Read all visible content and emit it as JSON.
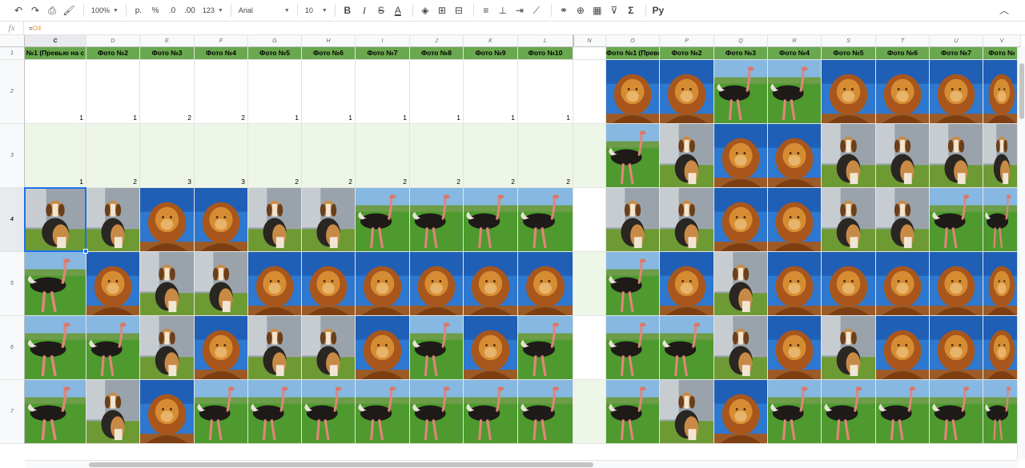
{
  "toolbar": {
    "zoom": "100%",
    "currency": "р.",
    "percent": "%",
    "decrease_decimals": ".0",
    "increase_decimals": ".00",
    "more_formats": "123",
    "font_name": "Arial",
    "font_size": "10",
    "bold": "B",
    "italic": "I",
    "strikethrough": "S",
    "text_color": "A",
    "functions": "Σ",
    "input_language": "Ру"
  },
  "formula_bar": {
    "fx": "fx",
    "equals": "=",
    "ref": "O4"
  },
  "columns": [
    "C",
    "D",
    "E",
    "F",
    "G",
    "H",
    "I",
    "J",
    "K",
    "L",
    "N",
    "O",
    "P",
    "Q",
    "R",
    "S",
    "T",
    "U",
    "V"
  ],
  "rows": [
    "1",
    "2",
    "3",
    "4",
    "5",
    "6",
    "7"
  ],
  "header_row": [
    "№1 (Превью на с",
    "Фото №2",
    "Фото №3",
    "Фото №4",
    "Фото №5",
    "Фото №6",
    "Фото №7",
    "Фото №8",
    "Фото №9",
    "Фото №10",
    "",
    "Фото №1 (Превью на",
    "Фото №2",
    "Фото №3",
    "Фото №4",
    "Фото №5",
    "Фото №6",
    "Фото №7",
    "Фото №"
  ],
  "number_rows": [
    [
      "1",
      "1",
      "2",
      "2",
      "1",
      "1",
      "1",
      "1",
      "1",
      "1"
    ],
    [
      "1",
      "2",
      "3",
      "3",
      "2",
      "2",
      "2",
      "2",
      "2",
      "2"
    ]
  ],
  "photo_grid_left": [
    [
      "dog",
      "dog",
      "lion",
      "lion",
      "dog",
      "dog",
      "ostrich",
      "ostrich",
      "ostrich",
      "ostrich"
    ],
    [
      "ostrich",
      "lion",
      "dog",
      "dog",
      "lion",
      "lion",
      "lion",
      "lion",
      "lion",
      "lion"
    ],
    [
      "ostrich",
      "ostrich",
      "dog",
      "lion",
      "dog",
      "dog",
      "lion",
      "ostrich",
      "lion",
      "ostrich"
    ],
    [
      "ostrich",
      "dog",
      "lion",
      "ostrich",
      "ostrich",
      "ostrich",
      "ostrich",
      "ostrich",
      "ostrich",
      "ostrich"
    ]
  ],
  "photo_grid_right": [
    [
      "lion",
      "lion",
      "ostrich",
      "ostrich",
      "lion",
      "lion",
      "lion",
      "lion"
    ],
    [
      "ostrich",
      "dog",
      "lion",
      "lion",
      "dog",
      "dog",
      "dog",
      "dog"
    ],
    [
      "dog",
      "dog",
      "lion",
      "lion",
      "dog",
      "dog",
      "ostrich",
      "ostrich"
    ],
    [
      "ostrich",
      "lion",
      "dog",
      "lion",
      "lion",
      "lion",
      "lion",
      "lion"
    ],
    [
      "ostrich",
      "ostrich",
      "dog",
      "lion",
      "dog",
      "lion",
      "lion",
      "lion"
    ],
    [
      "ostrich",
      "dog",
      "lion",
      "ostrich",
      "ostrich",
      "ostrich",
      "ostrich",
      "ostrich"
    ]
  ],
  "colors": {
    "header_green": "#6aa84f",
    "light_green": "#eef6e8",
    "selection_blue": "#1a73e8"
  }
}
